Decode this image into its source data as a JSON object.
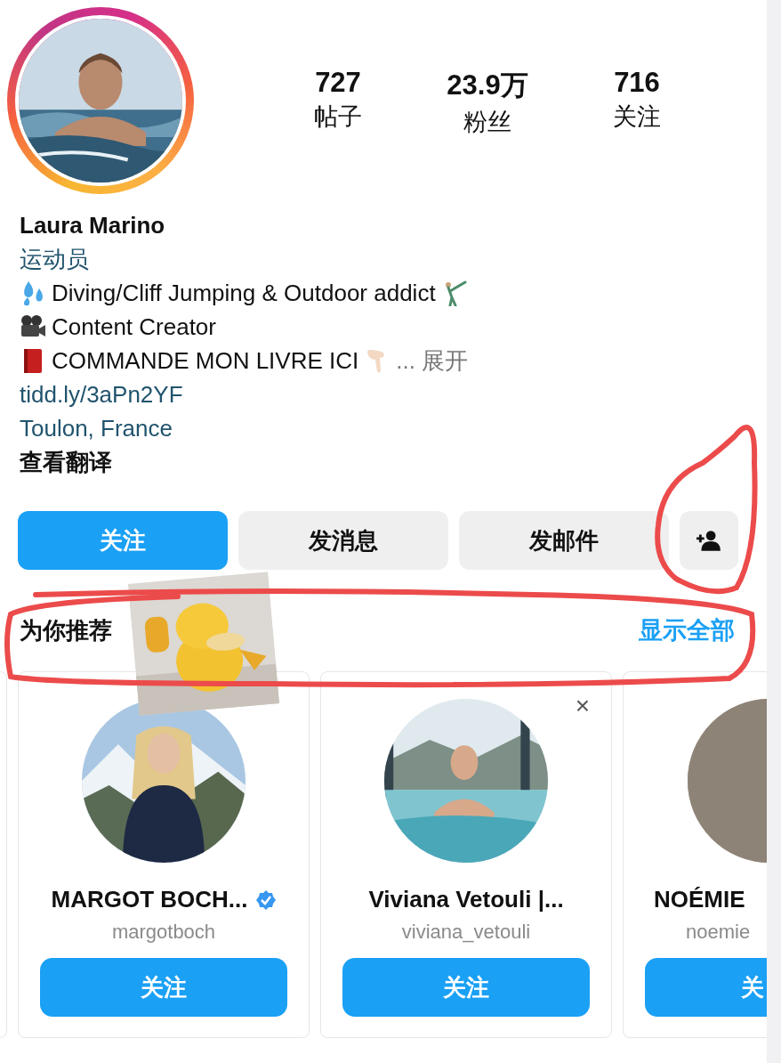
{
  "profile": {
    "stats": [
      {
        "value": "727",
        "label": "帖子"
      },
      {
        "value": "23.9万",
        "label": "粉丝"
      },
      {
        "value": "716",
        "label": "关注"
      }
    ],
    "name": "Laura Marino",
    "category": "运动员",
    "bio": [
      {
        "text": "Diving/Cliff Jumping & Outdoor addict"
      },
      {
        "text": "Content Creator"
      },
      {
        "text": "COMMANDE MON LIVRE ICI",
        "more": "... 展开"
      }
    ],
    "link": "tidd.ly/3aPn2YF",
    "location": "Toulon, France",
    "translate": "查看翻译"
  },
  "actions": [
    {
      "kind": "primary",
      "label": "关注"
    },
    {
      "kind": "secondary",
      "label": "发消息"
    },
    {
      "kind": "secondary",
      "label": "发邮件"
    },
    {
      "kind": "icon"
    }
  ],
  "suggestions": {
    "title": "为你推荐",
    "see_all": "显示全部",
    "cards": [
      {
        "name": "MARGOT BOCH...",
        "verified": true,
        "username": "margotboch",
        "button": "关注"
      },
      {
        "name": "Viviana Vetouli |...",
        "verified": false,
        "username": "viviana_vetouli",
        "button": "关注",
        "dismiss": "×"
      },
      {
        "name": "NOÉMIE",
        "verified": false,
        "username": "noemie",
        "button": "关"
      }
    ]
  }
}
